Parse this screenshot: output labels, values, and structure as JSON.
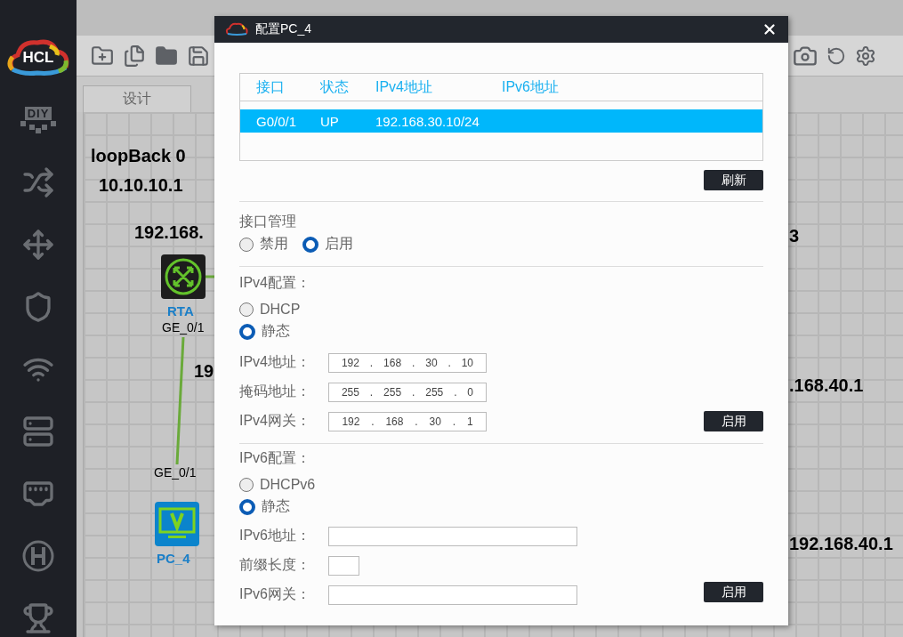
{
  "sidebar": {
    "logo_text": "HCL",
    "diy_text": "DIY"
  },
  "tabs": [
    {
      "label": "设计",
      "selected": true
    }
  ],
  "canvas": {
    "labels": [
      {
        "text": "loopBack 0",
        "kind": "address"
      },
      {
        "text": "10.10.10.1",
        "kind": "address"
      },
      {
        "text": "192.168.",
        "kind": "address"
      },
      {
        "text": "GE_0/1",
        "kind": "port"
      },
      {
        "text": "19",
        "kind": "address"
      },
      {
        "text": "GE_0/1",
        "kind": "port"
      },
      {
        "text": "3",
        "kind": "address"
      },
      {
        "text": ".168.40.1",
        "kind": "address"
      },
      {
        "text": "192.168.40.1",
        "kind": "address"
      }
    ],
    "devices": [
      {
        "name": "RTA",
        "kind": "router"
      },
      {
        "name": "PC_4",
        "kind": "pc"
      }
    ]
  },
  "dialog": {
    "title": "配置PC_4",
    "table": {
      "columns": [
        "接口",
        "状态",
        "IPv4地址",
        "IPv6地址"
      ],
      "rows": [
        {
          "cells": [
            "G0/0/1",
            "UP",
            "192.168.30.10/24"
          ],
          "selected": true
        }
      ]
    },
    "refresh_button": "刷新",
    "interface_admin": {
      "label": "接口管理",
      "options": [
        {
          "label": "禁用",
          "selected": false
        },
        {
          "label": "启用",
          "selected": true
        }
      ]
    },
    "ipv4": {
      "heading": "IPv4配置：",
      "separator": ".",
      "modes": [
        {
          "label": "DHCP",
          "selected": false
        },
        {
          "label": "静态",
          "selected": true
        }
      ],
      "fields": [
        {
          "label": "IPv4地址：",
          "octets": [
            "192",
            "168",
            "30",
            "10"
          ]
        },
        {
          "label": "掩码地址：",
          "octets": [
            "255",
            "255",
            "255",
            "0"
          ]
        },
        {
          "label": "IPv4网关：",
          "octets": [
            "192",
            "168",
            "30",
            "1"
          ]
        }
      ],
      "apply_button": "启用"
    },
    "ipv6": {
      "heading": "IPv6配置：",
      "modes": [
        {
          "label": "DHCPv6",
          "selected": false
        },
        {
          "label": "静态",
          "selected": true
        }
      ],
      "fields": [
        {
          "label": "IPv6地址：",
          "kind": "address"
        },
        {
          "label": "前缀长度：",
          "kind": "prefix"
        },
        {
          "label": "IPv6网关：",
          "kind": "address"
        }
      ],
      "apply_button": "启用"
    }
  }
}
